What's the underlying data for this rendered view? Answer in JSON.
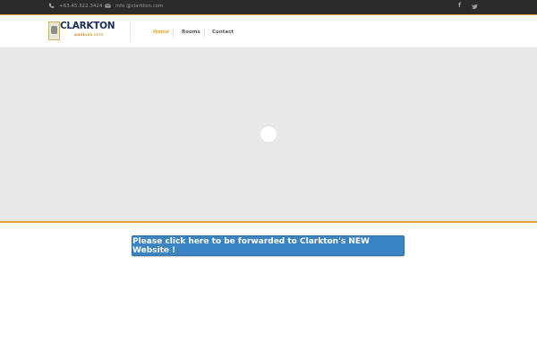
{
  "topbar": {
    "phone": "+63.45.322.3424",
    "email": "info @clarkton.com",
    "social": {
      "facebook_glyph": "f",
      "twitter_icon": "twitter-icon"
    }
  },
  "header": {
    "logo_name": "CLARKTON",
    "logo_sub": "ANGELES CITY",
    "nav": [
      "Home",
      "Rooms",
      "Contact"
    ],
    "active_nav": "Home"
  },
  "slider": {
    "loading": true
  },
  "cta": {
    "label": "Please click here to be forwarded to Clarkton's NEW Website !"
  },
  "colors": {
    "accent": "#e2a640",
    "cta": "#3a84c3",
    "topbar": "#2b2b2b",
    "logo_text": "#1e2f5c"
  }
}
